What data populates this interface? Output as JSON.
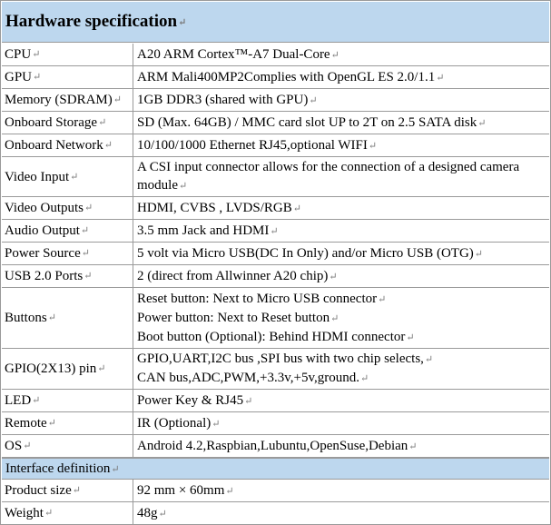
{
  "title": "Hardware specification",
  "rows": [
    {
      "label": "CPU",
      "value": [
        "A20 ARM Cortex™-A7 Dual-Core"
      ]
    },
    {
      "label": "GPU",
      "value": [
        "ARM Mali400MP2Complies with OpenGL ES 2.0/1.1"
      ]
    },
    {
      "label": "Memory (SDRAM)",
      "value": [
        "1GB DDR3 (shared with GPU)"
      ]
    },
    {
      "label": "Onboard Storage",
      "value": [
        "SD (Max. 64GB) / MMC card slot UP to 2T on 2.5 SATA disk"
      ]
    },
    {
      "label": "Onboard Network",
      "value": [
        "10/100/1000 Ethernet RJ45,optional WIFI"
      ]
    },
    {
      "label": "Video Input",
      "value": [
        "A CSI input connector allows for the connection of a designed camera",
        "module"
      ]
    },
    {
      "label": "Video Outputs",
      "value": [
        "HDMI, CVBS , LVDS/RGB"
      ]
    },
    {
      "label": "Audio Output",
      "value": [
        "3.5 mm Jack and HDMI"
      ]
    },
    {
      "label": "Power Source",
      "value": [
        "5 volt via Micro USB(DC In Only) and/or Micro USB (OTG)"
      ]
    },
    {
      "label": "USB 2.0 Ports",
      "value": [
        "2 (direct from Allwinner A20 chip)"
      ]
    },
    {
      "label": "Buttons",
      "value": [
        "Reset button: Next to Micro USB connector",
        "Power button: Next to Reset button",
        "Boot button (Optional): Behind HDMI connector"
      ]
    },
    {
      "label": "GPIO(2X13) pin",
      "value": [
        "GPIO,UART,I2C bus ,SPI bus with two chip selects,",
        "CAN bus,ADC,PWM,+3.3v,+5v,ground."
      ]
    },
    {
      "label": "LED",
      "value": [
        "Power Key & RJ45"
      ]
    },
    {
      "label": "Remote",
      "value": [
        "IR (Optional)"
      ]
    },
    {
      "label": "OS",
      "value": [
        "Android 4.2,Raspbian,Lubuntu,OpenSuse,Debian"
      ]
    }
  ],
  "interface_title": "Interface definition",
  "interface_rows": [
    {
      "label": "Product size",
      "value": [
        "92 mm × 60mm"
      ]
    },
    {
      "label": "Weight",
      "value": [
        "48g"
      ]
    }
  ],
  "paragraph_mark": "↵"
}
